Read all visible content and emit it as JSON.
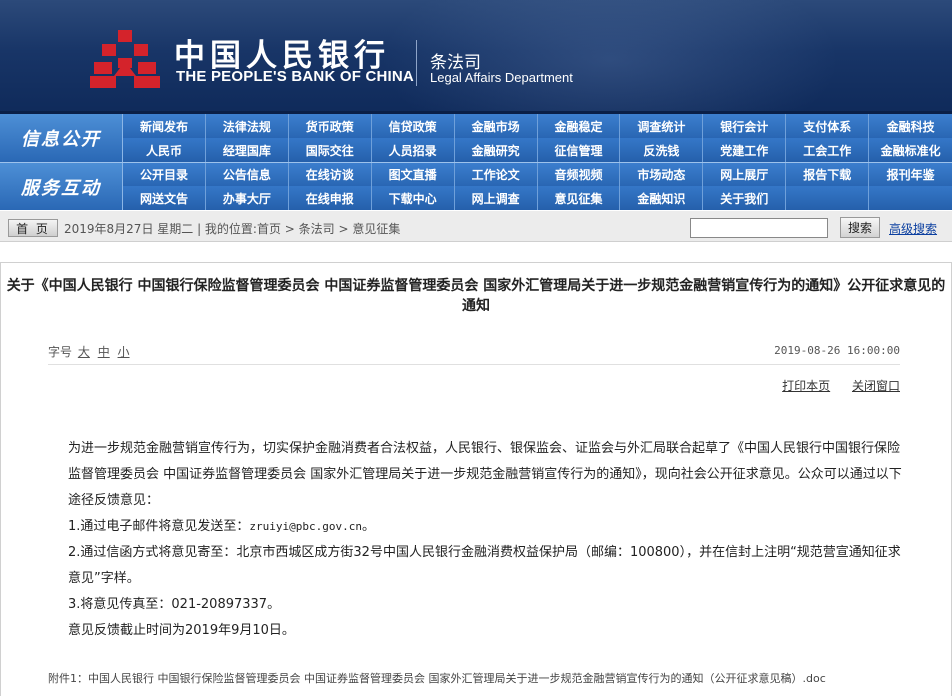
{
  "header": {
    "cn_name": "中国人民银行",
    "en_name": "THE PEOPLE'S BANK OF CHINA",
    "dept_cn": "条法司",
    "dept_en": "Legal Affairs Department"
  },
  "nav": {
    "group1_label": "信息公开",
    "group2_label": "服务互动",
    "rows": [
      [
        "新闻发布",
        "法律法规",
        "货币政策",
        "信贷政策",
        "金融市场",
        "金融稳定",
        "调查统计",
        "银行会计",
        "支付体系",
        "金融科技"
      ],
      [
        "人民币",
        "经理国库",
        "国际交往",
        "人员招录",
        "金融研究",
        "征信管理",
        "反洗钱",
        "党建工作",
        "工会工作",
        "金融标准化"
      ],
      [
        "公开目录",
        "公告信息",
        "在线访谈",
        "图文直播",
        "工作论文",
        "音频视频",
        "市场动态",
        "网上展厅",
        "报告下载",
        "报刊年鉴"
      ],
      [
        "网送文告",
        "办事大厅",
        "在线申报",
        "下载中心",
        "网上调查",
        "意见征集",
        "金融知识",
        "关于我们"
      ]
    ]
  },
  "breadcrumb": {
    "home": "首 页",
    "text": "2019年8月27日  星期二 | 我的位置:首页 > 条法司 > 意见征集",
    "search_btn": "搜索",
    "adv_search": "高级搜索"
  },
  "article": {
    "title": "关于《中国人民银行  中国银行保险监督管理委员会  中国证券监督管理委员会  国家外汇管理局关于进一步规范金融营销宣传行为的通知》公开征求意见的通知",
    "font_label": "字号",
    "sizes": [
      "大",
      "中",
      "小"
    ],
    "date": "2019-08-26 16:00:00",
    "print": "打印本页",
    "close": "关闭窗口",
    "para1": "为进一步规范金融营销宣传行为，切实保护金融消费者合法权益，人民银行、银保监会、证监会与外汇局联合起草了《中国人民银行中国银行保险监督管理委员会 中国证券监督管理委员会 国家外汇管理局关于进一步规范金融营销宣传行为的通知》，现向社会公开征求意见。公众可以通过以下途径反馈意见：",
    "item1_prefix": "1.通过电子邮件将意见发送至：",
    "item1_email": "zruiyi@pbc.gov.cn",
    "item1_suffix": "。",
    "item2": "2.通过信函方式将意见寄至：北京市西城区成方街32号中国人民银行金融消费权益保护局（邮编：100800），并在信封上注明“规范营宣通知征求意见”字样。",
    "item3": "3.将意见传真至：021-20897337。",
    "deadline": "意见反馈截止时间为2019年9月10日。",
    "attachment": "附件1：中国人民银行 中国银行保险监督管理委员会 中国证券监督管理委员会 国家外汇管理局关于进一步规范金融营销宣传行为的通知（公开征求意见稿）.doc"
  },
  "colors": {
    "banner": "#183567",
    "nav": "#2f6fbf",
    "logo_red": "#d4232b"
  }
}
